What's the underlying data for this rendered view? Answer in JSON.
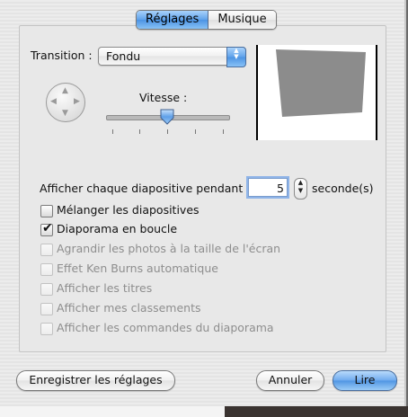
{
  "tabs": [
    {
      "label": "Réglages",
      "selected": true
    },
    {
      "label": "Musique",
      "selected": false
    }
  ],
  "transition": {
    "label": "Transition :",
    "selected_value": "Fondu"
  },
  "speed": {
    "label": "Vitesse :",
    "level": 0.5
  },
  "display_time": {
    "prefix": "Afficher chaque diapositive pendant",
    "value": "5",
    "suffix": "seconde(s)"
  },
  "options": [
    {
      "label": "Mélanger les diapositives",
      "checked": false,
      "enabled": true
    },
    {
      "label": "Diaporama en boucle",
      "checked": true,
      "enabled": true
    },
    {
      "label": "Agrandir les photos à la taille de l'écran",
      "checked": false,
      "enabled": false
    },
    {
      "label": "Effet Ken Burns automatique",
      "checked": false,
      "enabled": false
    },
    {
      "label": "Afficher les titres",
      "checked": false,
      "enabled": false
    },
    {
      "label": "Afficher mes classements",
      "checked": false,
      "enabled": false
    },
    {
      "label": "Afficher les commandes du diaporama",
      "checked": false,
      "enabled": false
    }
  ],
  "buttons": {
    "save": "Enregistrer les réglages",
    "cancel": "Annuler",
    "play": "Lire"
  },
  "colors": {
    "accent": "#5fa2ea",
    "preview_shape": "#8c8c8c"
  }
}
